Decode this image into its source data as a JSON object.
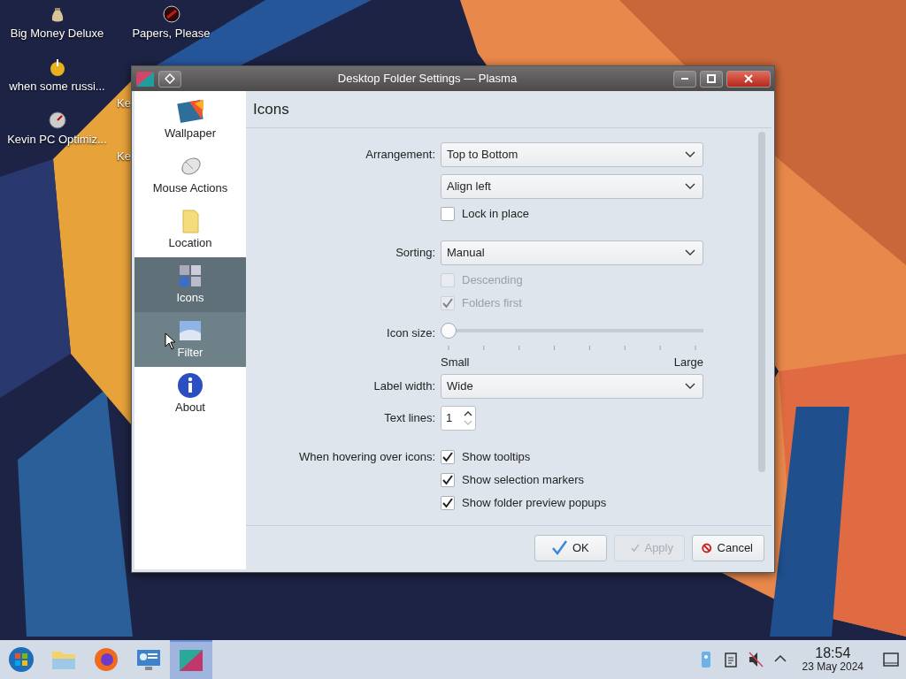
{
  "desktop_columns": [
    [
      {
        "kind": "moneybag",
        "label": "Big Money Deluxe"
      },
      {
        "kind": "gold",
        "label": "when some russi..."
      },
      {
        "kind": "gauge",
        "label": "Kevin PC Optimiz..."
      }
    ],
    [
      {
        "kind": "redcircle",
        "label": "Papers, Please"
      },
      {
        "kind": "covered",
        "label": "Ke"
      },
      {
        "kind": "covered",
        "label": "Ke"
      }
    ]
  ],
  "window": {
    "title": "Desktop Folder Settings — Plasma",
    "sidebar": [
      {
        "kind": "wallpaper",
        "label": "Wallpaper",
        "selected": false,
        "hovered": false
      },
      {
        "kind": "mouse",
        "label": "Mouse Actions",
        "selected": false,
        "hovered": false
      },
      {
        "kind": "folder",
        "label": "Location",
        "selected": false,
        "hovered": false
      },
      {
        "kind": "icons",
        "label": "Icons",
        "selected": true,
        "hovered": false
      },
      {
        "kind": "filter",
        "label": "Filter",
        "selected": false,
        "hovered": true
      },
      {
        "kind": "info",
        "label": "About",
        "selected": false,
        "hovered": false
      }
    ],
    "page_title": "Icons",
    "sections": [
      [
        {
          "kind": "combo",
          "label": "Arrangement:",
          "value": "Top to Bottom"
        },
        {
          "kind": "combo",
          "value": "Align left"
        },
        {
          "kind": "checkbox",
          "text": "Lock in place",
          "checked": false,
          "disabled": false
        }
      ],
      [
        {
          "kind": "combo",
          "label": "Sorting:",
          "value": "Manual"
        },
        {
          "kind": "checkbox",
          "text": "Descending",
          "checked": false,
          "disabled": true
        },
        {
          "kind": "checkbox",
          "text": "Folders first",
          "checked": true,
          "disabled": true
        }
      ],
      [
        {
          "kind": "slider",
          "label": "Icon size:",
          "level": 0,
          "min_label": "Small",
          "max_label": "Large"
        },
        {
          "kind": "combo",
          "label": "Label width:",
          "value": "Wide"
        },
        {
          "kind": "spin",
          "label": "Text lines:",
          "value": "1"
        }
      ],
      [
        {
          "kind": "checkbox",
          "label": "When hovering over icons:",
          "text": "Show tooltips",
          "checked": true,
          "disabled": false
        },
        {
          "kind": "checkbox",
          "text": "Show selection markers",
          "checked": true,
          "disabled": false
        },
        {
          "kind": "checkbox",
          "text": "Show folder preview popups",
          "checked": true,
          "disabled": false
        }
      ]
    ],
    "buttons": [
      {
        "kind": "ok",
        "label": "OK",
        "disabled": false
      },
      {
        "kind": "apply",
        "label": "Apply",
        "disabled": true
      },
      {
        "kind": "cancel",
        "label": "Cancel",
        "disabled": false
      }
    ]
  },
  "taskbar": {
    "apps": [
      {
        "kind": "start",
        "active": false
      },
      {
        "kind": "files",
        "active": false
      },
      {
        "kind": "browser",
        "active": false
      },
      {
        "kind": "monitor",
        "active": false
      },
      {
        "kind": "settings",
        "active": true
      }
    ],
    "tray": [
      {
        "kind": "phone"
      },
      {
        "kind": "clipboard"
      },
      {
        "kind": "muted"
      },
      {
        "kind": "chevron"
      }
    ],
    "clock": {
      "time": "18:54",
      "date": "23 May 2024"
    }
  }
}
